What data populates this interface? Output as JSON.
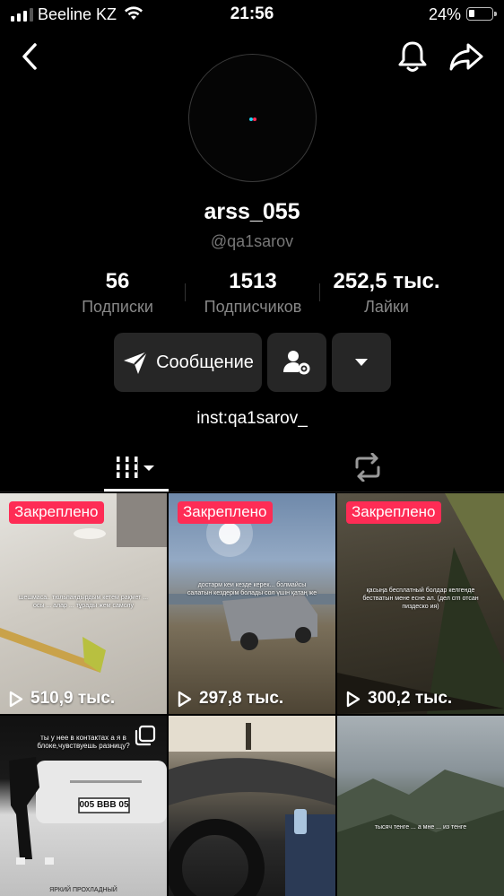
{
  "status_bar": {
    "carrier": "Beeline KZ",
    "time": "21:56",
    "battery_percent_text": "24%",
    "battery_level": 0.24
  },
  "top_nav": {
    "icons": [
      "chevron-left-icon",
      "bell-icon",
      "share-icon"
    ]
  },
  "profile": {
    "display_name": "arss_055",
    "username": "@qa1sarov",
    "stats": [
      {
        "value": "56",
        "label": "Подписки"
      },
      {
        "value": "1513",
        "label": "Подписчиков"
      },
      {
        "value": "252,5 тыс.",
        "label": "Лайки"
      }
    ],
    "message_button_label": "Сообщение",
    "bio": "inst:qa1sarov_"
  },
  "tabs": {
    "active": "videos",
    "icons": [
      "video-grid-icon",
      "repost-icon"
    ]
  },
  "videos": [
    {
      "pinned_label": "Закреплено",
      "views": "510,9 тыс.",
      "caption": "шешмаса.. тюльпандырдым кетем рақмет ... осы ... алар ... тұрады жем самолу"
    },
    {
      "pinned_label": "Закреплено",
      "views": "297,8 тыс.",
      "caption": "достарм кеи кездe керек... болмайсы салатын кездерім болады сол үшін қатаң же"
    },
    {
      "pinned_label": "Закреплено",
      "views": "300,2 тыс.",
      "caption": "қасыңа бесплатный болдар келгенде бестватын мене есне ал. (дел сгп отсан пиздеско ия)"
    },
    {
      "caption": "ты у нее в контактах а я в блоке,чувствуешь разницу?",
      "plate": "005 BBB 05",
      "bottom_text": "ЯРКИЙ ПРОХЛАДНЫЙ"
    },
    {
      "caption": ""
    },
    {
      "caption": "тысяч тенге ... а мне ... из тенге"
    }
  ],
  "colors": {
    "background": "#000000",
    "pin_badge": "#fe2c55",
    "button_bg": "#262626",
    "muted_text": "#888888"
  }
}
